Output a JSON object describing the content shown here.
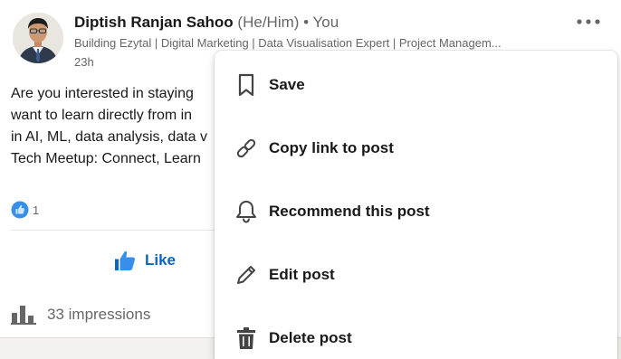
{
  "post": {
    "author": {
      "name": "Diptish Ranjan Sahoo",
      "pronouns": "(He/Him)",
      "you_badge": "• You",
      "headline": "Building Ezytal | Digital Marketing | Data Visualisation Expert | Project Managem...",
      "timestamp": "23h"
    },
    "text_lines": [
      "Are you interested in staying",
      "want to learn directly from in",
      "in AI, ML, data analysis, data v",
      "Tech Meetup: Connect, Learn"
    ],
    "reactions": {
      "count": "1",
      "icon": "like-reaction-icon"
    },
    "actions": {
      "like_label": "Like"
    },
    "impressions": {
      "label": "33 impressions"
    }
  },
  "menu": {
    "items": [
      {
        "label": "Save",
        "icon": "bookmark-icon"
      },
      {
        "label": "Copy link to post",
        "icon": "link-icon"
      },
      {
        "label": "Recommend this post",
        "icon": "bell-icon"
      },
      {
        "label": "Edit post",
        "icon": "pencil-icon"
      },
      {
        "label": "Delete post",
        "icon": "trash-icon"
      }
    ]
  },
  "colors": {
    "brand_blue": "#0a66c2",
    "secondary_text": "#666666",
    "icon_gray": "#444444"
  }
}
